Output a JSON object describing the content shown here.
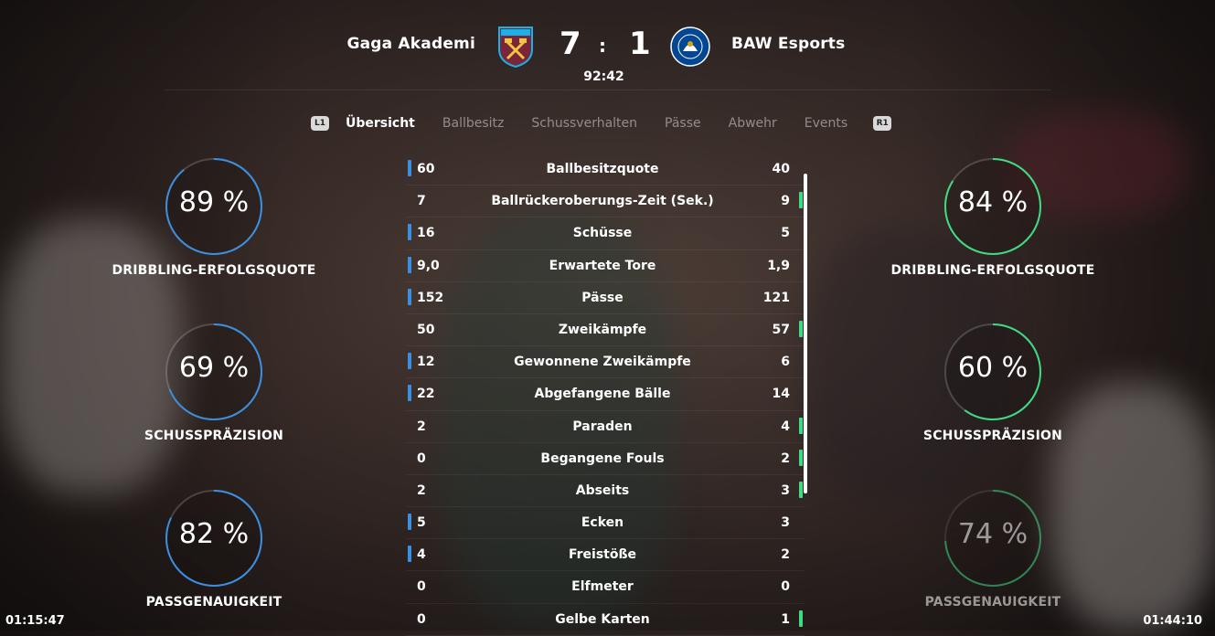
{
  "header": {
    "home_team": "Gaga Akademi",
    "away_team": "BAW Esports",
    "home_score": "7",
    "separator": ":",
    "away_score": "1",
    "match_time": "92:42",
    "home_crest_text": "WEST HAM UNITED",
    "away_crest_text": "CHELSEA"
  },
  "tabs": {
    "left_button": "L1",
    "right_button": "R1",
    "items": [
      "Übersicht",
      "Ballbesitz",
      "Schussverhalten",
      "Pässe",
      "Abwehr",
      "Events"
    ],
    "active": "Übersicht"
  },
  "home_rings": [
    {
      "value": "89 %",
      "label": "DRIBBLING-ERFOLGSQUOTE",
      "fraction": 0.89
    },
    {
      "value": "69 %",
      "label": "SCHUSSPRÄZISION",
      "fraction": 0.69
    },
    {
      "value": "82 %",
      "label": "PASSGENAUIGKEIT",
      "fraction": 0.82
    }
  ],
  "away_rings": [
    {
      "value": "84 %",
      "label": "DRIBBLING-ERFOLGSQUOTE",
      "fraction": 0.84
    },
    {
      "value": "60 %",
      "label": "SCHUSSPRÄZISION",
      "fraction": 0.6
    },
    {
      "value": "74 %",
      "label": "PASSGENAUIGKEIT",
      "fraction": 0.74
    }
  ],
  "stats": [
    {
      "home": "60",
      "name": "Ballbesitzquote",
      "away": "40",
      "leader": "home"
    },
    {
      "home": "7",
      "name": "Ballrückeroberungs-Zeit (Sek.)",
      "away": "9",
      "leader": "away"
    },
    {
      "home": "16",
      "name": "Schüsse",
      "away": "5",
      "leader": "home"
    },
    {
      "home": "9,0",
      "name": "Erwartete Tore",
      "away": "1,9",
      "leader": "home"
    },
    {
      "home": "152",
      "name": "Pässe",
      "away": "121",
      "leader": "home"
    },
    {
      "home": "50",
      "name": "Zweikämpfe",
      "away": "57",
      "leader": "away"
    },
    {
      "home": "12",
      "name": "Gewonnene Zweikämpfe",
      "away": "6",
      "leader": "home"
    },
    {
      "home": "22",
      "name": "Abgefangene Bälle",
      "away": "14",
      "leader": "home"
    },
    {
      "home": "2",
      "name": "Paraden",
      "away": "4",
      "leader": "away"
    },
    {
      "home": "0",
      "name": "Begangene Fouls",
      "away": "2",
      "leader": "away"
    },
    {
      "home": "2",
      "name": "Abseits",
      "away": "3",
      "leader": "away"
    },
    {
      "home": "5",
      "name": "Ecken",
      "away": "3",
      "leader": "home"
    },
    {
      "home": "4",
      "name": "Freistöße",
      "away": "2",
      "leader": "home"
    },
    {
      "home": "0",
      "name": "Elfmeter",
      "away": "0",
      "leader": "none"
    },
    {
      "home": "0",
      "name": "Gelbe Karten",
      "away": "1",
      "leader": "away"
    }
  ],
  "timestamps": {
    "left": "01:15:47",
    "right": "01:44:10"
  },
  "colors": {
    "home_accent": "#3a8fe0",
    "away_accent": "#3ddc84",
    "west_ham_claret": "#7a263a",
    "west_ham_blue": "#1bb1e7",
    "chelsea_blue": "#034694"
  }
}
